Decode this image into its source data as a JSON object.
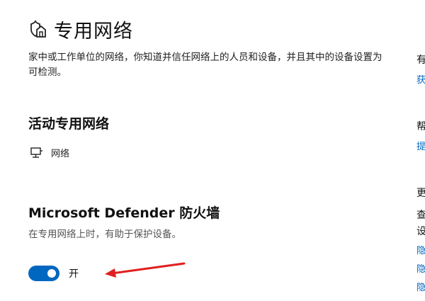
{
  "header": {
    "title": "专用网络",
    "icon": "home-shield-icon"
  },
  "description": "家中或工作单位的网络，你知道并信任网络上的人员和设备，并且其中的设备设置为可检测。",
  "active_network": {
    "heading": "活动专用网络",
    "icon": "monitor-network-icon",
    "name": "网络"
  },
  "firewall": {
    "heading": "Microsoft Defender 防火墙",
    "description": "在专用网络上时，有助于保护设备。",
    "toggle_state": "on",
    "toggle_label": "开"
  },
  "annotation": {
    "icon": "red-arrow-icon",
    "color": "#e02020"
  },
  "right_column": {
    "fragments": [
      {
        "text": "有",
        "style": "dark"
      },
      {
        "text": "获",
        "style": "link"
      },
      {
        "text": "帮",
        "style": "dark"
      },
      {
        "text": "提",
        "style": "link"
      },
      {
        "text": "更",
        "style": "dark"
      },
      {
        "text": "查",
        "style": "dark"
      },
      {
        "text": "设",
        "style": "dark"
      },
      {
        "text": "隐",
        "style": "link"
      },
      {
        "text": "隐",
        "style": "link"
      },
      {
        "text": "隐",
        "style": "link"
      }
    ]
  },
  "colors": {
    "accent": "#0067c0",
    "text": "#1a1a1a",
    "muted": "#555555"
  }
}
